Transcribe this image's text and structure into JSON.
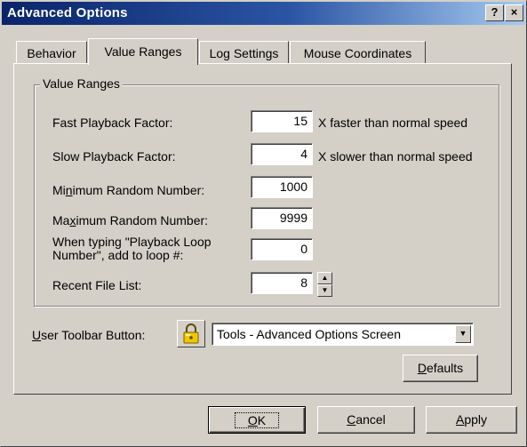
{
  "window": {
    "title": "Advanced Options"
  },
  "titlebar_buttons": {
    "help": "?",
    "close": "×"
  },
  "tabs": [
    {
      "label": "Behavior",
      "active": false
    },
    {
      "label": "Value Ranges",
      "active": true
    },
    {
      "label": "Log Settings",
      "active": false
    },
    {
      "label": "Mouse Coordinates",
      "active": false
    }
  ],
  "group": {
    "label": "Value Ranges"
  },
  "fields": {
    "fast_playback": {
      "label": "Fast Playback Factor:",
      "value": "15",
      "suffix": "X faster than normal speed"
    },
    "slow_playback": {
      "label": "Slow Playback Factor:",
      "value": "4",
      "suffix": "X slower than normal speed"
    },
    "min_random": {
      "label_pre": "Mi",
      "label_key": "n",
      "label_post": "imum Random Number:",
      "value": "1000"
    },
    "max_random": {
      "label_pre": "Ma",
      "label_key": "x",
      "label_post": "imum Random Number:",
      "value": "9999"
    },
    "loop_number": {
      "label": "When typing \"Playback Loop Number\", add to loop #:",
      "value": "0"
    },
    "recent_files": {
      "label": "Recent File List:",
      "value": "8"
    }
  },
  "toolbar": {
    "label_key": "U",
    "label_rest": "ser Toolbar Button:",
    "icon": "lock-icon",
    "selected": "Tools - Advanced Options Screen"
  },
  "buttons": {
    "defaults": {
      "key": "D",
      "rest": "efaults"
    },
    "ok": {
      "key": "O",
      "rest": "K"
    },
    "cancel": {
      "key": "C",
      "rest": "ancel"
    },
    "apply": {
      "key": "A",
      "rest": "pply"
    }
  }
}
